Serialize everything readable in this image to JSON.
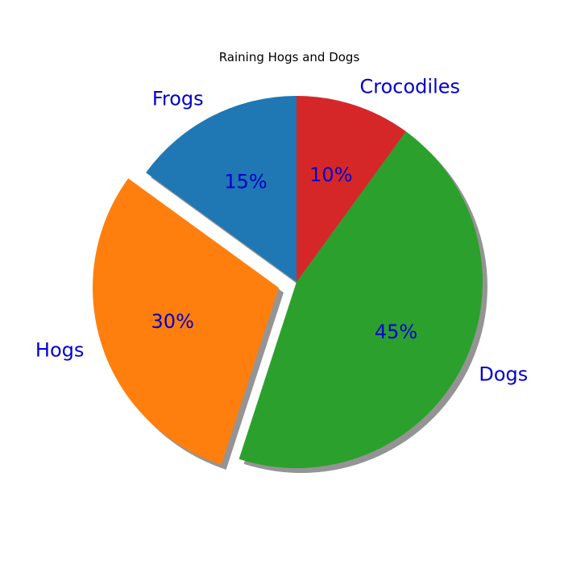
{
  "chart_data": {
    "type": "pie",
    "title": "Raining Hogs and Dogs",
    "categories": [
      "Frogs",
      "Hogs",
      "Dogs",
      "Crocodiles"
    ],
    "values": [
      15,
      30,
      45,
      10
    ],
    "percent_labels": [
      "15%",
      "30%",
      "45%",
      "10%"
    ],
    "colors": [
      "#1f77b4",
      "#ff7f0e",
      "#2ca02c",
      "#d62728"
    ],
    "exploded": [
      false,
      true,
      false,
      false
    ],
    "explode_fraction": 0.1,
    "start_angle_deg": 90,
    "direction": "counterclockwise",
    "shadow": true,
    "label_color": "#0000cc"
  }
}
